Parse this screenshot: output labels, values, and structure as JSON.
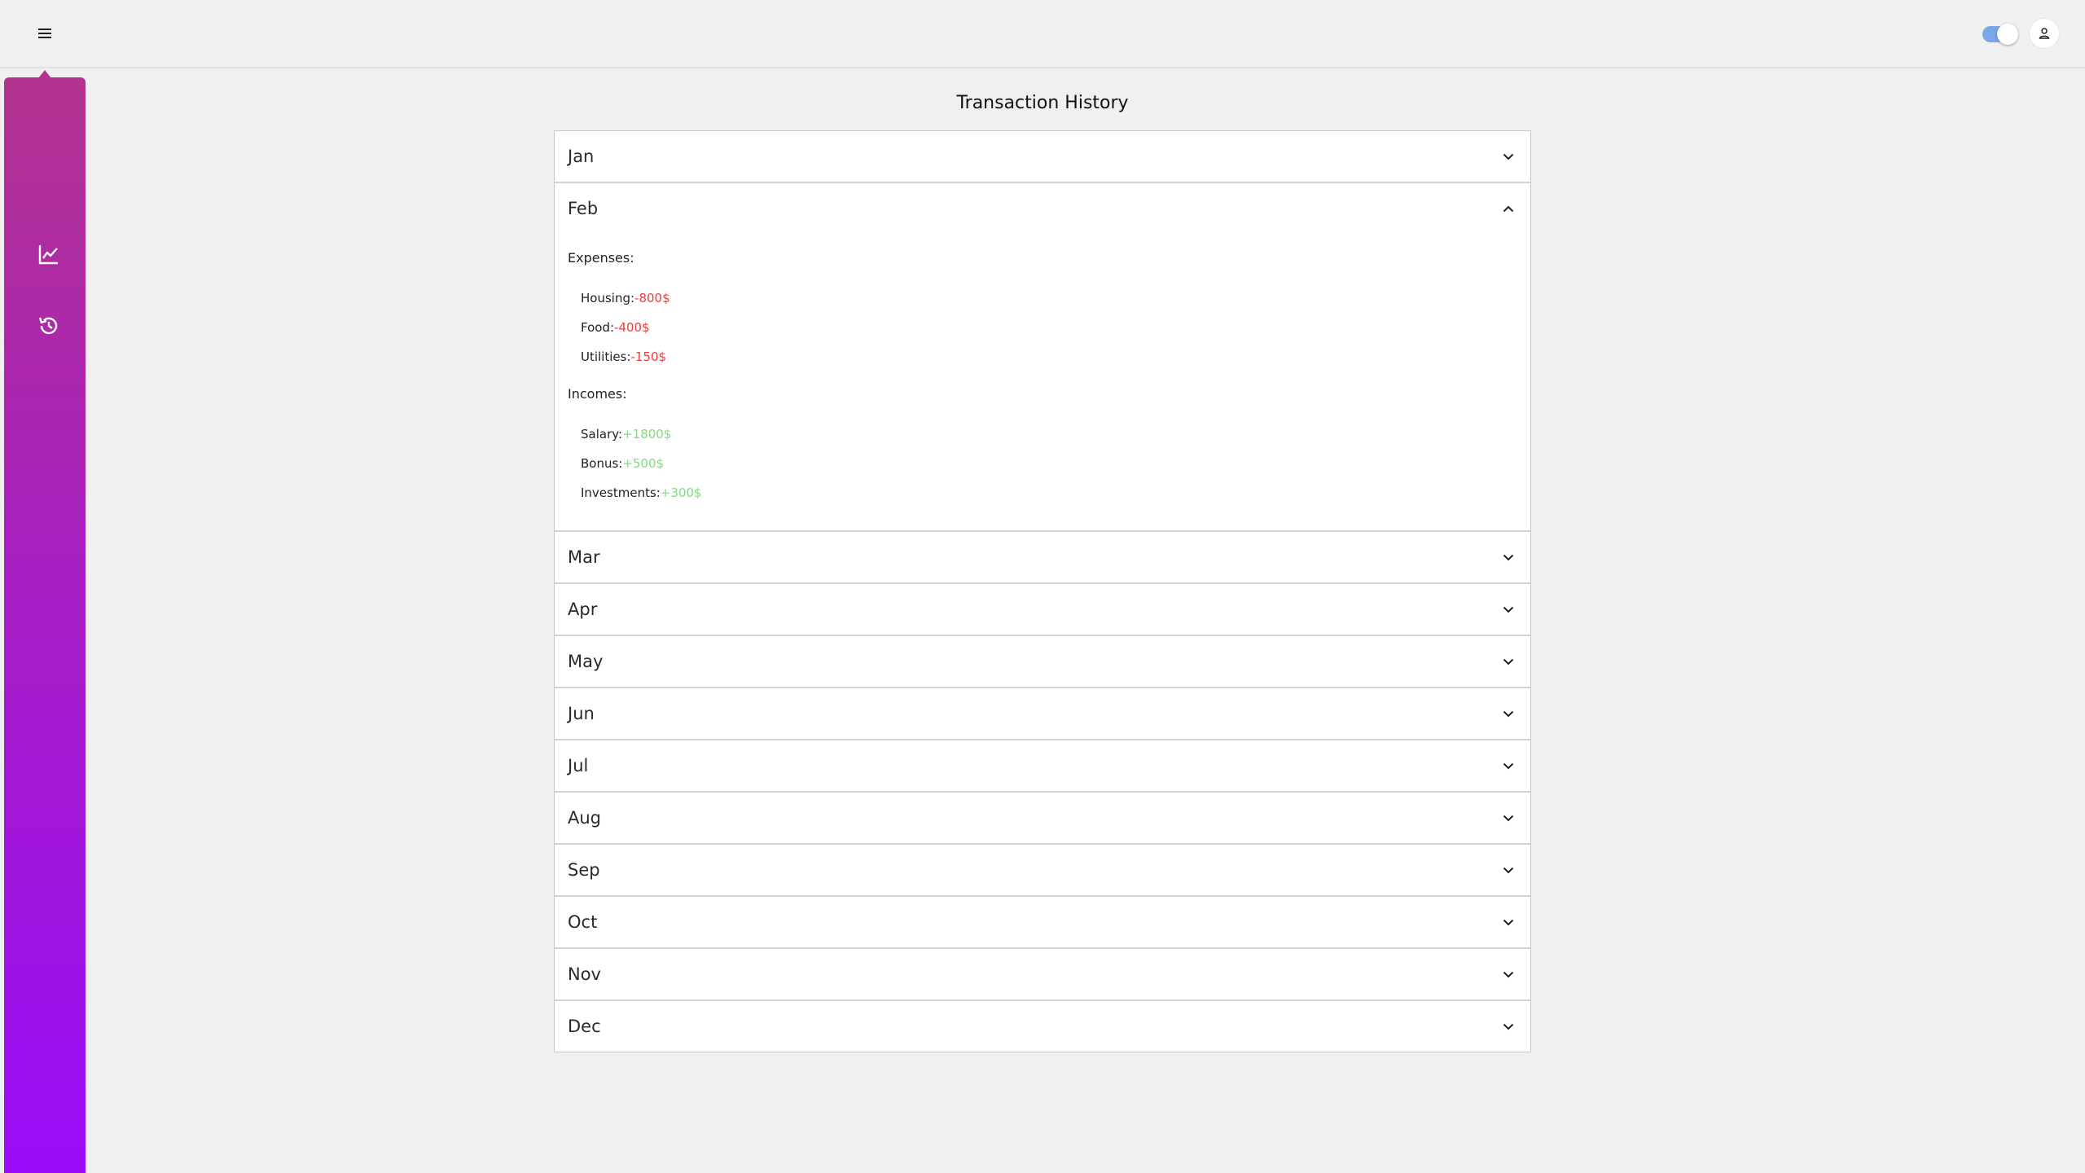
{
  "header": {
    "menu_icon": "hamburger-menu-icon",
    "theme_toggle_on": true,
    "user_icon": "user-icon"
  },
  "sidebar": {
    "items": [
      {
        "icon": "chart-line-icon"
      },
      {
        "icon": "history-icon"
      }
    ]
  },
  "main": {
    "title": "Transaction History",
    "months": [
      {
        "label": "Jan",
        "expanded": false
      },
      {
        "label": "Feb",
        "expanded": true,
        "expenses_title": "Expenses:",
        "expenses": [
          {
            "name": "Housing:",
            "amount": "-800$"
          },
          {
            "name": "Food:",
            "amount": "-400$"
          },
          {
            "name": "Utilities:",
            "amount": "-150$"
          }
        ],
        "incomes_title": "Incomes:",
        "incomes": [
          {
            "name": "Salary:",
            "amount": "+1800$"
          },
          {
            "name": "Bonus:",
            "amount": "+500$"
          },
          {
            "name": "Investments:",
            "amount": "+300$"
          }
        ]
      },
      {
        "label": "Mar",
        "expanded": false
      },
      {
        "label": "Apr",
        "expanded": false
      },
      {
        "label": "May",
        "expanded": false
      },
      {
        "label": "Jun",
        "expanded": false
      },
      {
        "label": "Jul",
        "expanded": false
      },
      {
        "label": "Aug",
        "expanded": false
      },
      {
        "label": "Sep",
        "expanded": false
      },
      {
        "label": "Oct",
        "expanded": false
      },
      {
        "label": "Nov",
        "expanded": false
      },
      {
        "label": "Dec",
        "expanded": false
      }
    ]
  },
  "colors": {
    "sidebar_top": "#b2338f",
    "sidebar_bottom": "#9a0cf8",
    "expense": "#ee3b3b",
    "income": "#7fdc7f",
    "toggle": "#7aa7e6"
  }
}
